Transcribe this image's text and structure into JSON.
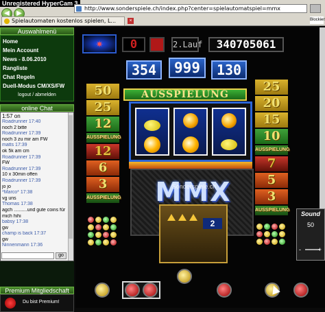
{
  "app_title": "Unregistered HyperCam 3",
  "browser": {
    "address": "http://www.sonderspiele.ch/index.php?center=spielautomatspiel=mmx",
    "tab_label": "Spielautomaten kostenlos spielen, L...",
    "new_tab_label": "Blockierse"
  },
  "sidebar": {
    "menu_title": "Auswahlmenü",
    "menu_items": [
      {
        "label": "Home"
      },
      {
        "label": "Mein Account"
      },
      {
        "label": "News - 8.06.2010"
      },
      {
        "label": "Rangliste"
      },
      {
        "label": "Chat Regeln"
      },
      {
        "label": "Duell-Modus CM/XS/FW"
      },
      {
        "label": "logout / abmelden"
      }
    ],
    "chat_title": "online Chat",
    "chat_time": "1:57 on",
    "chat_lines": [
      {
        "text": "Roadrunner 17:40",
        "type": "name"
      },
      {
        "text": "noch 2 bitte",
        "type": "msg"
      },
      {
        "text": "Roadrunner 17:39",
        "type": "name"
      },
      {
        "text": "noch 3 zu mir am FW",
        "type": "msg"
      },
      {
        "text": "matts 17:39",
        "type": "name"
      },
      {
        "text": "ok 5k am cm",
        "type": "msg"
      },
      {
        "text": "Roadrunner 17:39",
        "type": "name"
      },
      {
        "text": "FW",
        "type": "msg"
      },
      {
        "text": "Roadrunner 17:39",
        "type": "name"
      },
      {
        "text": "10 x 30min offen",
        "type": "msg"
      },
      {
        "text": "Roadrunner 17:39",
        "type": "name"
      },
      {
        "text": "jo jo",
        "type": "msg"
      },
      {
        "text": "*Marco* 17:38",
        "type": "name"
      },
      {
        "text": "vg uns",
        "type": "msg"
      },
      {
        "text": "Thomas 17:38",
        "type": "name"
      },
      {
        "text": "agch ..........und gute coins für",
        "type": "msg"
      },
      {
        "text": "mich hihi",
        "type": "msg"
      },
      {
        "text": "babsy 17:38",
        "type": "name"
      },
      {
        "text": "gw",
        "type": "msg"
      },
      {
        "text": "champ is back 17:37",
        "type": "name"
      },
      {
        "text": "gw",
        "type": "msg"
      },
      {
        "text": "Ninnenmann 17:36",
        "type": "name"
      }
    ],
    "chat_go": "go",
    "premium_title": "Premium Mitgliedschaft",
    "premium_text": "Du bist Premium!"
  },
  "game": {
    "left_counter": "0",
    "lauf_label": "2.Lauf",
    "credit_display": "340705061",
    "top_numbers": [
      "354",
      "999",
      "130"
    ],
    "banner": "AUSSPIELUNG",
    "left_ladder": [
      "50",
      "25",
      "12",
      "AUSSPIELUNG",
      "12",
      "6",
      "3",
      "AUSSPIELUNG"
    ],
    "right_ladder": [
      "25",
      "20",
      "15",
      "10",
      "AUSSPIELUNG",
      "7",
      "5",
      "3",
      "AUSSPIELUNG"
    ],
    "logo": "MMX",
    "watermark": "Sonderspiele.ch",
    "lower_value": "2",
    "sound_label": "Sound",
    "sound_value": "50",
    "sound_minus": "-",
    "sound_plus": "+"
  }
}
